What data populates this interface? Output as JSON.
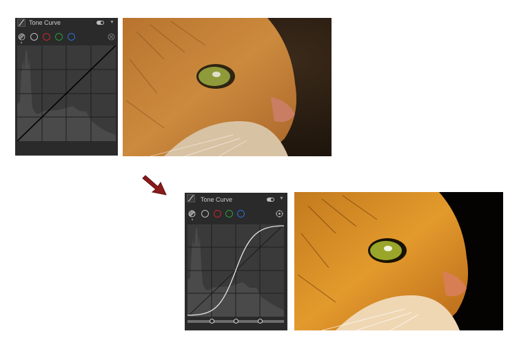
{
  "before_panel": {
    "title": "Tone Curve",
    "channels": [
      "luminance",
      "rgb",
      "red",
      "green",
      "blue"
    ],
    "channel_colors": [
      "#aaaaaa",
      "#bdbdbd",
      "#c62828",
      "#2e9d3a",
      "#2a6fd6"
    ],
    "toggle_state": "on",
    "curve": "linear"
  },
  "after_panel": {
    "title": "Tone Curve",
    "channels": [
      "luminance",
      "rgb",
      "red",
      "green",
      "blue"
    ],
    "channel_colors": [
      "#aaaaaa",
      "#bdbdbd",
      "#c62828",
      "#2e9d3a",
      "#2a6fd6"
    ],
    "toggle_state": "on",
    "curve": "s-curve",
    "split_handles": 3
  },
  "icons": {
    "curve": "tone-curve-icon",
    "target": "target-adjust-icon",
    "toggle": "toggle-switch-icon",
    "menu": "menu-arrow-icon",
    "arrow": "red-arrow-icon"
  },
  "colors": {
    "panel_bg": "#2a2a2a",
    "graph_bg": "#3a3a3a",
    "arrow": "#8b1a1a"
  }
}
